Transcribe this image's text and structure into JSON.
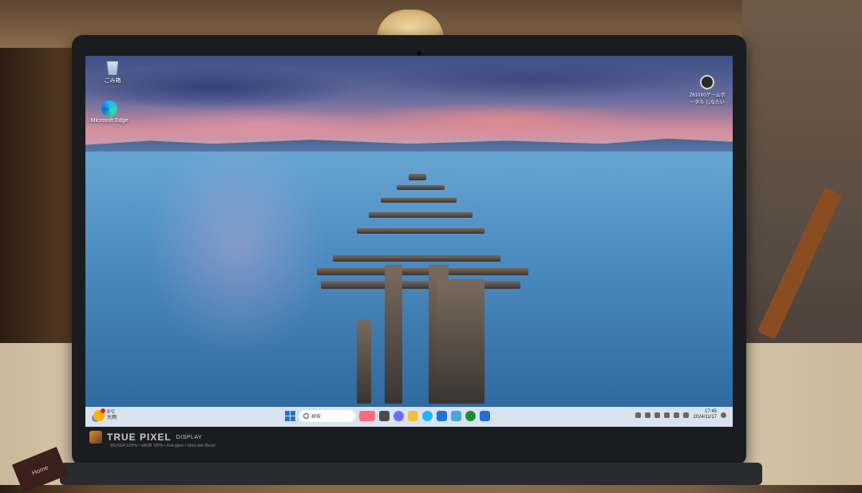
{
  "desktop": {
    "icons": [
      {
        "label": "ごみ箱",
        "icon": "recycle-bin-icon"
      },
      {
        "label": "Microsoft Edge",
        "icon": "edge-icon"
      }
    ],
    "top_right_icon": {
      "label": "Z610X0ゲームポータル\nしなたい",
      "icon": "portal-icon"
    }
  },
  "taskbar": {
    "weather": {
      "temp": "9°C",
      "condition": "大雨"
    },
    "search_placeholder": "検索",
    "apps": [
      {
        "name": "search-app-icon",
        "color": "#ff6a7a"
      },
      {
        "name": "taskview-icon",
        "color": "#4b4b4b"
      },
      {
        "name": "copilot-icon",
        "color": "#6b6bff"
      },
      {
        "name": "file-explorer-icon",
        "color": "#f3c23a"
      },
      {
        "name": "edge-taskbar-icon",
        "color": "#1db5ff"
      },
      {
        "name": "store-icon",
        "color": "#1e73d6"
      },
      {
        "name": "photos-icon",
        "color": "#45a6e0"
      },
      {
        "name": "xbox-icon",
        "color": "#1a8f30"
      },
      {
        "name": "mail-icon",
        "color": "#1e6fd9"
      }
    ],
    "clock": {
      "time": "17:45",
      "date": "2024/11/17"
    }
  },
  "laptop": {
    "brand": "TRUE PIXEL",
    "brand_suffix": "DISPLAY",
    "brand_sub": "WUXGA 120Hz • sRGB 100% • Anti-glare • Ultra-slim Bezel"
  },
  "sticker": {
    "text": "Home"
  }
}
